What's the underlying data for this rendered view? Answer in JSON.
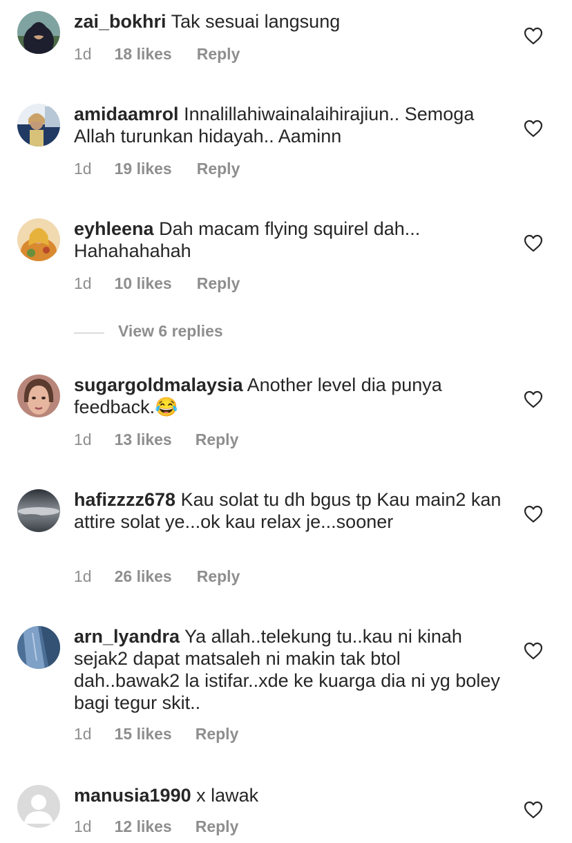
{
  "comments": [
    {
      "username": "zai_bokhri",
      "text": "Tak sesuai langsung",
      "time": "1d",
      "likes": "18 likes",
      "reply": "Reply",
      "avatar": "avatar-woman-hijab-black"
    },
    {
      "username": "amidaamrol",
      "text": "Innalillahiwainalaihirajiun.. Semoga Allah turunkan hidayah.. Aaminn",
      "time": "1d",
      "likes": "19 likes",
      "reply": "Reply",
      "avatar": "avatar-woman-car"
    },
    {
      "username": "eyhleena",
      "text": "Dah macam flying squirel dah... Hahahahahah",
      "time": "1d",
      "likes": "10 likes",
      "reply": "Reply",
      "avatar": "avatar-woman-hijab-floral"
    },
    {
      "username": "sugargoldmalaysia",
      "text": "Another level dia punya feedback.😂",
      "time": "1d",
      "likes": "13 likes",
      "reply": "Reply",
      "avatar": "avatar-woman-portrait"
    },
    {
      "username": "hafizzzz678",
      "text": "Kau solat tu dh bgus tp Kau main2 kan attire solat ye...ok kau relax je...sooner",
      "time": "1d",
      "likes": "26 likes",
      "reply": "Reply",
      "avatar": "avatar-sky-clouds"
    },
    {
      "username": "arn_lyandra",
      "text": "Ya allah..telekung tu..kau ni kinah sejak2 dapat matsaleh ni makin tak btol dah..bawak2 la istifar..xde ke kuarga dia ni yg boley bagi tegur skit..",
      "time": "1d",
      "likes": "15 likes",
      "reply": "Reply",
      "avatar": "avatar-jeans"
    },
    {
      "username": "manusia1990",
      "text": "x lawak",
      "time": "1d",
      "likes": "12 likes",
      "reply": "Reply",
      "avatar": "avatar-default-person"
    }
  ],
  "view_replies": "View 6 replies",
  "icons": {
    "like": "heart-outline-icon"
  },
  "colors": {
    "text": "#262626",
    "meta": "#8e8e8e",
    "divider": "#dbdbdb"
  }
}
